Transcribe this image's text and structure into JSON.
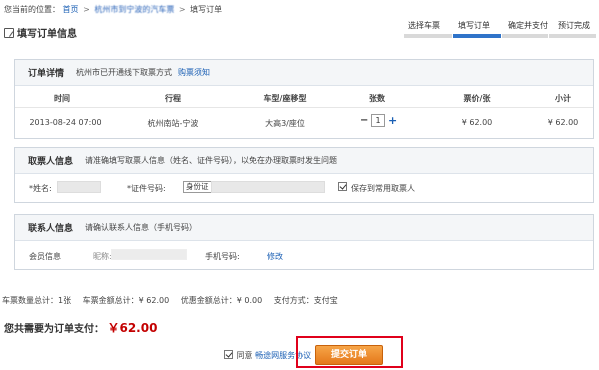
{
  "breadcrumb": {
    "prefix": "您当前的位置：",
    "home": "首页",
    "route": "杭州市到宁波的汽车票",
    "current": "填写订单",
    "separator": ">"
  },
  "page_title": "填写订单信息",
  "steps": [
    "选择车票",
    "填写订单",
    "确定并支付",
    "预订完成"
  ],
  "steps_active_index": 1,
  "order": {
    "title": "订单详情",
    "desc": "杭州市已开通线下取票方式",
    "notice_link": "购票须知",
    "columns": [
      "时间",
      "行程",
      "车型/座移型",
      "张数",
      "票价/张",
      "小计"
    ],
    "row": {
      "time": "2013-08-24  07:00",
      "route": "杭州南站-宁波",
      "seat_type": "大高3/座位",
      "minus": "−",
      "quantity": "1",
      "plus": "+",
      "price": "¥ 62.00",
      "subtotal": "¥ 62.00"
    }
  },
  "taker": {
    "title": "取票人信息",
    "desc": "请准确填写取票人信息（姓名、证件号码），以免在办理取票时发生问题",
    "name_label": "*姓名:",
    "id_label": "*证件号码:",
    "id_type": "身份证",
    "save_label": "保存到常用取票人"
  },
  "contact": {
    "title": "联系人信息",
    "desc": "请确认联系人信息（手机号码）",
    "member_label": "会员信息",
    "nickname_label": "昵称:",
    "phone_label": "手机号码:",
    "edit_link": "修改"
  },
  "summary": {
    "ticket_count": "车票数量总计：1张",
    "ticket_amount": "车票金额总计：¥ 62.00",
    "discount": "优惠金额总计：¥ 0.00",
    "payment": "支付方式：支付宝"
  },
  "total": {
    "label": "您共需要为订单支付：",
    "amount": "￥62.00"
  },
  "agree": {
    "prefix": "同意",
    "link": "畅途网服务协议"
  },
  "submit_label": "提交订单",
  "colors": {
    "accent": "#2f73c9",
    "price": "#c30000",
    "button": "#e4781a",
    "highlight": "#e0001b"
  }
}
